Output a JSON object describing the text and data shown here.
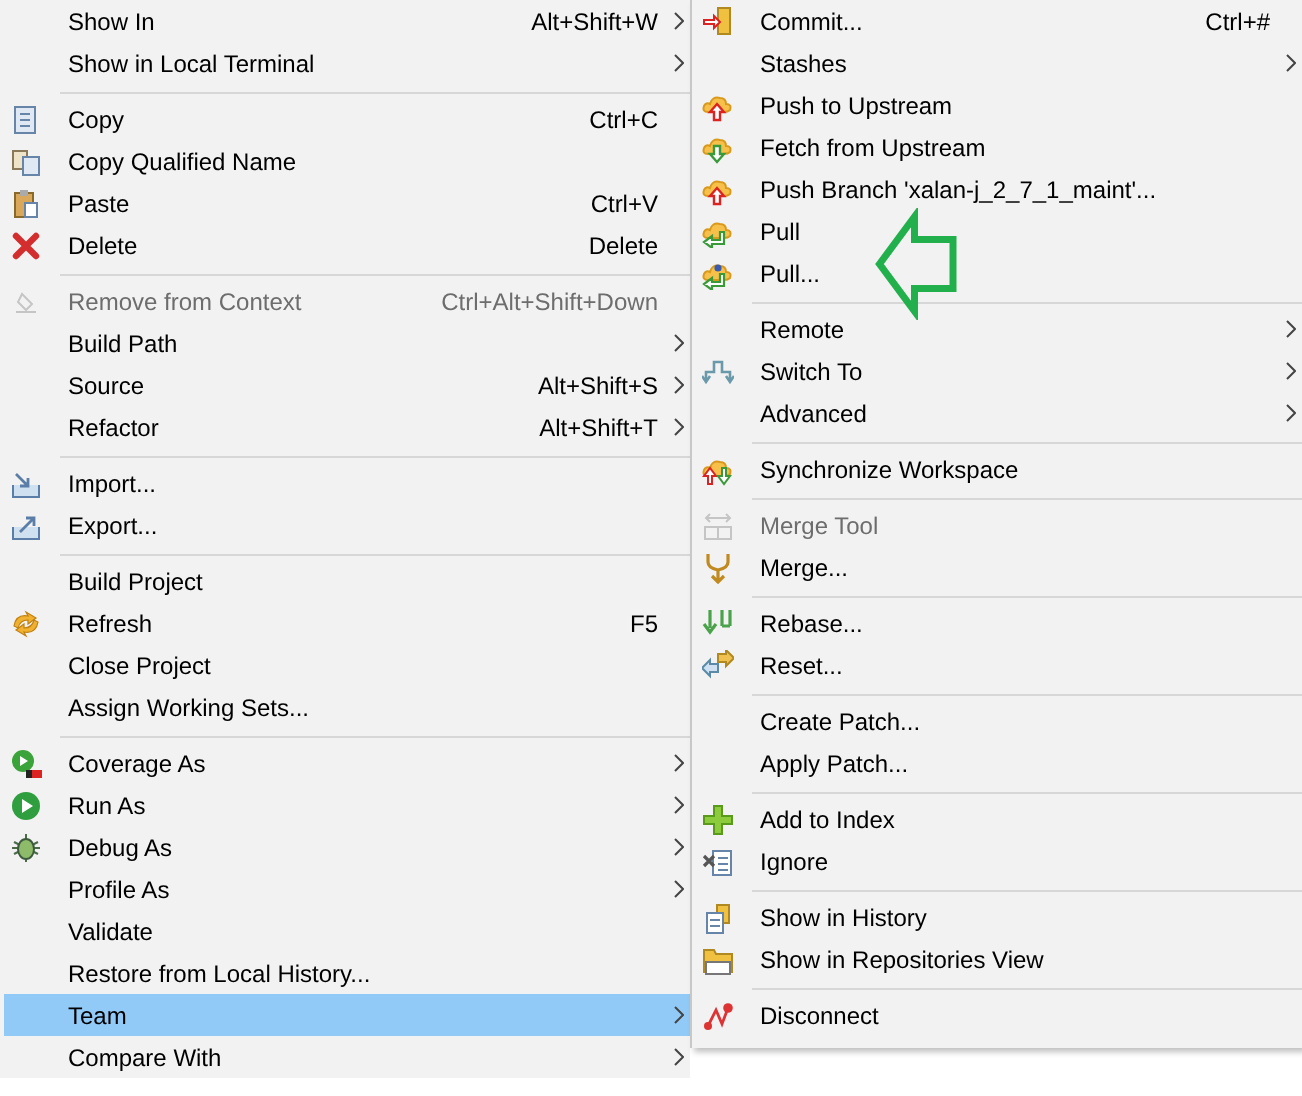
{
  "context_menu": {
    "items": [
      {
        "kind": "item",
        "label": "Show In",
        "shortcut": "Alt+Shift+W",
        "submenu": true,
        "disabled": false,
        "selected": false
      },
      {
        "kind": "item",
        "label": "Show in Local Terminal",
        "submenu": true,
        "disabled": false,
        "selected": false
      },
      {
        "kind": "separator"
      },
      {
        "kind": "item",
        "label": "Copy",
        "shortcut": "Ctrl+C",
        "submenu": false,
        "disabled": false,
        "selected": false
      },
      {
        "kind": "item",
        "label": "Copy Qualified Name",
        "submenu": false,
        "disabled": false,
        "selected": false
      },
      {
        "kind": "item",
        "label": "Paste",
        "shortcut": "Ctrl+V",
        "submenu": false,
        "disabled": false,
        "selected": false
      },
      {
        "kind": "item",
        "label": "Delete",
        "shortcut": "Delete",
        "submenu": false,
        "disabled": false,
        "selected": false
      },
      {
        "kind": "separator"
      },
      {
        "kind": "item",
        "label": "Remove from Context",
        "shortcut": "Ctrl+Alt+Shift+Down",
        "submenu": false,
        "disabled": true,
        "selected": false
      },
      {
        "kind": "item",
        "label": "Build Path",
        "submenu": true,
        "disabled": false,
        "selected": false
      },
      {
        "kind": "item",
        "label": "Source",
        "shortcut": "Alt+Shift+S",
        "submenu": true,
        "disabled": false,
        "selected": false
      },
      {
        "kind": "item",
        "label": "Refactor",
        "shortcut": "Alt+Shift+T",
        "submenu": true,
        "disabled": false,
        "selected": false
      },
      {
        "kind": "separator"
      },
      {
        "kind": "item",
        "label": "Import...",
        "submenu": false,
        "disabled": false,
        "selected": false
      },
      {
        "kind": "item",
        "label": "Export...",
        "submenu": false,
        "disabled": false,
        "selected": false
      },
      {
        "kind": "separator"
      },
      {
        "kind": "item",
        "label": "Build Project",
        "submenu": false,
        "disabled": false,
        "selected": false
      },
      {
        "kind": "item",
        "label": "Refresh",
        "shortcut": "F5",
        "submenu": false,
        "disabled": false,
        "selected": false
      },
      {
        "kind": "item",
        "label": "Close Project",
        "submenu": false,
        "disabled": false,
        "selected": false
      },
      {
        "kind": "item",
        "label": "Assign Working Sets...",
        "submenu": false,
        "disabled": false,
        "selected": false
      },
      {
        "kind": "separator"
      },
      {
        "kind": "item",
        "label": "Coverage As",
        "submenu": true,
        "disabled": false,
        "selected": false
      },
      {
        "kind": "item",
        "label": "Run As",
        "submenu": true,
        "disabled": false,
        "selected": false
      },
      {
        "kind": "item",
        "label": "Debug As",
        "submenu": true,
        "disabled": false,
        "selected": false
      },
      {
        "kind": "item",
        "label": "Profile As",
        "submenu": true,
        "disabled": false,
        "selected": false
      },
      {
        "kind": "item",
        "label": "Validate",
        "submenu": false,
        "disabled": false,
        "selected": false
      },
      {
        "kind": "item",
        "label": "Restore from Local History...",
        "submenu": false,
        "disabled": false,
        "selected": false
      },
      {
        "kind": "item",
        "label": "Team",
        "submenu": true,
        "disabled": false,
        "selected": true
      },
      {
        "kind": "item",
        "label": "Compare With",
        "submenu": true,
        "disabled": false,
        "selected": false
      }
    ]
  },
  "team_submenu": {
    "items": [
      {
        "kind": "item",
        "label": "Commit...",
        "shortcut": "Ctrl+#",
        "submenu": false,
        "disabled": false,
        "selected": false
      },
      {
        "kind": "item",
        "label": "Stashes",
        "submenu": true,
        "disabled": false,
        "selected": false
      },
      {
        "kind": "item",
        "label": "Push to Upstream",
        "submenu": false,
        "disabled": false,
        "selected": false
      },
      {
        "kind": "item",
        "label": "Fetch from Upstream",
        "submenu": false,
        "disabled": false,
        "selected": false
      },
      {
        "kind": "item",
        "label": "Push Branch 'xalan-j_2_7_1_maint'...",
        "submenu": false,
        "disabled": false,
        "selected": false
      },
      {
        "kind": "item",
        "label": "Pull",
        "submenu": false,
        "disabled": false,
        "selected": false
      },
      {
        "kind": "item",
        "label": "Pull...",
        "submenu": false,
        "disabled": false,
        "selected": false
      },
      {
        "kind": "separator"
      },
      {
        "kind": "item",
        "label": "Remote",
        "submenu": true,
        "disabled": false,
        "selected": false
      },
      {
        "kind": "item",
        "label": "Switch To",
        "submenu": true,
        "disabled": false,
        "selected": false
      },
      {
        "kind": "item",
        "label": "Advanced",
        "submenu": true,
        "disabled": false,
        "selected": false
      },
      {
        "kind": "separator"
      },
      {
        "kind": "item",
        "label": "Synchronize Workspace",
        "submenu": false,
        "disabled": false,
        "selected": false
      },
      {
        "kind": "separator"
      },
      {
        "kind": "item",
        "label": "Merge Tool",
        "submenu": false,
        "disabled": true,
        "selected": false
      },
      {
        "kind": "item",
        "label": "Merge...",
        "submenu": false,
        "disabled": false,
        "selected": false
      },
      {
        "kind": "separator"
      },
      {
        "kind": "item",
        "label": "Rebase...",
        "submenu": false,
        "disabled": false,
        "selected": false
      },
      {
        "kind": "item",
        "label": "Reset...",
        "submenu": false,
        "disabled": false,
        "selected": false
      },
      {
        "kind": "separator"
      },
      {
        "kind": "item",
        "label": "Create Patch...",
        "submenu": false,
        "disabled": false,
        "selected": false
      },
      {
        "kind": "item",
        "label": "Apply Patch...",
        "submenu": false,
        "disabled": false,
        "selected": false
      },
      {
        "kind": "separator"
      },
      {
        "kind": "item",
        "label": "Add to Index",
        "submenu": false,
        "disabled": false,
        "selected": false
      },
      {
        "kind": "item",
        "label": "Ignore",
        "submenu": false,
        "disabled": false,
        "selected": false
      },
      {
        "kind": "separator"
      },
      {
        "kind": "item",
        "label": "Show in History",
        "submenu": false,
        "disabled": false,
        "selected": false
      },
      {
        "kind": "item",
        "label": "Show in Repositories View",
        "submenu": false,
        "disabled": false,
        "selected": false
      },
      {
        "kind": "separator"
      },
      {
        "kind": "item",
        "label": "Disconnect",
        "submenu": false,
        "disabled": false,
        "selected": false
      }
    ]
  }
}
